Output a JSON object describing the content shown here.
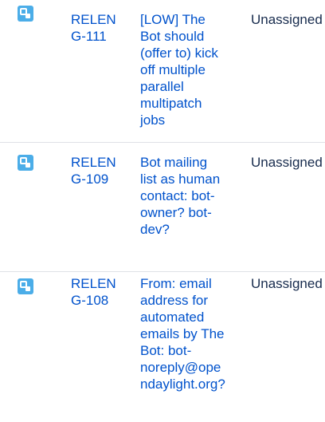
{
  "rows": [
    {
      "type_icon": "subtask-icon",
      "key": "RELENG-111",
      "summary": "[LOW] The Bot should (offer to) kick off multiple parallel multipatch jobs",
      "assignee": "Unassigned"
    },
    {
      "type_icon": "subtask-icon",
      "key": "RELENG-109",
      "summary": "Bot mailing list as human contact: bot-owner? bot-dev?",
      "assignee": "Unassigned"
    },
    {
      "type_icon": "subtask-icon",
      "key": "RELENG-108",
      "summary": "From: email address for automated emails by The Bot: bot-noreply@opendaylight.org?",
      "assignee": "Unassigned"
    }
  ],
  "colors": {
    "link": "#0052cc",
    "text": "#172b4d",
    "icon_bg": "#4bade8",
    "divider": "#dfe1e6"
  }
}
